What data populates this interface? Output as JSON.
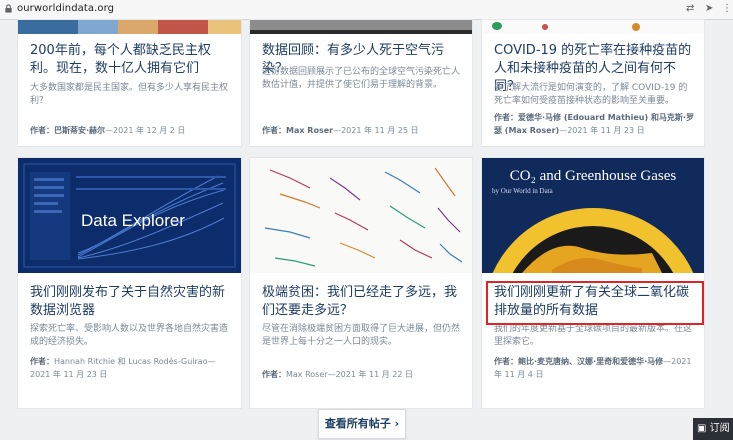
{
  "browser": {
    "url": "ourworldindata.org",
    "icons": [
      "lock-icon",
      "translate-icon",
      "send-icon",
      "menu-icon"
    ]
  },
  "cards": [
    {
      "title": "200年前，每个人都缺乏民主权利。现在，数十亿人拥有它们",
      "excerpt": "大多数国家都是民主国家。但有多少人享有民主权利？",
      "author_label": "作者：",
      "author": "巴斯蒂安·赫尔",
      "date": "—2021 年 12 月 2 日"
    },
    {
      "title": "数据回顾：有多少人死于空气污染？",
      "excerpt": "这份数据回顾展示了已公布的全球空气污染死亡人数估计值，并提供了使它们易于理解的背景。",
      "author_label": "作者：",
      "author": "Max Roser",
      "date": "—2021 年 11 月 25 日"
    },
    {
      "title": "COVID-19 的死亡率在接种疫苗的人和未接种疫苗的人之间有何不同？",
      "excerpt": "要了解大流行是如何演变的，了解 COVID-19 的死亡率如何受疫苗接种状态的影响至关重要。",
      "author_label": "作者：",
      "author": "爱德华·马修 (Edouard Mathieu) 和马克斯·罗瑟 (Max Roser)",
      "date": "—2021 年 11 月 23 日"
    },
    {
      "thumb_text": "Data Explorer",
      "title": "我们刚刚发布了关于自然灾害的新数据浏览器",
      "excerpt": "探索死亡率、受影响人数以及世界各地自然灾害造成的经济损失。",
      "author_label": "作者：",
      "author": "Hannah Ritchie 和 Lucas Rodés-Guirao",
      "date": "—2021 年 11 月 23 日"
    },
    {
      "title": "极端贫困：我们已经走了多远，我们还要走多远？",
      "excerpt": "尽管在消除极端贫困方面取得了巨大进展，但仍然是世界上每十分之一人口的现实。",
      "author_label": "作者：",
      "author": "Max Roser",
      "date": "—2021 年 11 月 22 日"
    },
    {
      "thumb_title": "CO₂ and Greenhouse Gases",
      "thumb_sub": "by Our World in Data",
      "title": "我们刚刚更新了有关全球二氧化碳排放量的所有数据",
      "excerpt": "我们的年度更新基于全球碳项目的最新版本。在这里探索它。",
      "author_label": "作者：",
      "author": "鲍比·麦克唐纳、汉娜·里奇和爱德华·马修",
      "date": "—2021 年 11 月 4 日"
    }
  ],
  "view_all": "查看所有帖子 ›",
  "subscribe": "订阅",
  "colors": {
    "accent": "#e02424",
    "navy": "#1d3d63",
    "thumb_blue": "#0d2c6b"
  }
}
